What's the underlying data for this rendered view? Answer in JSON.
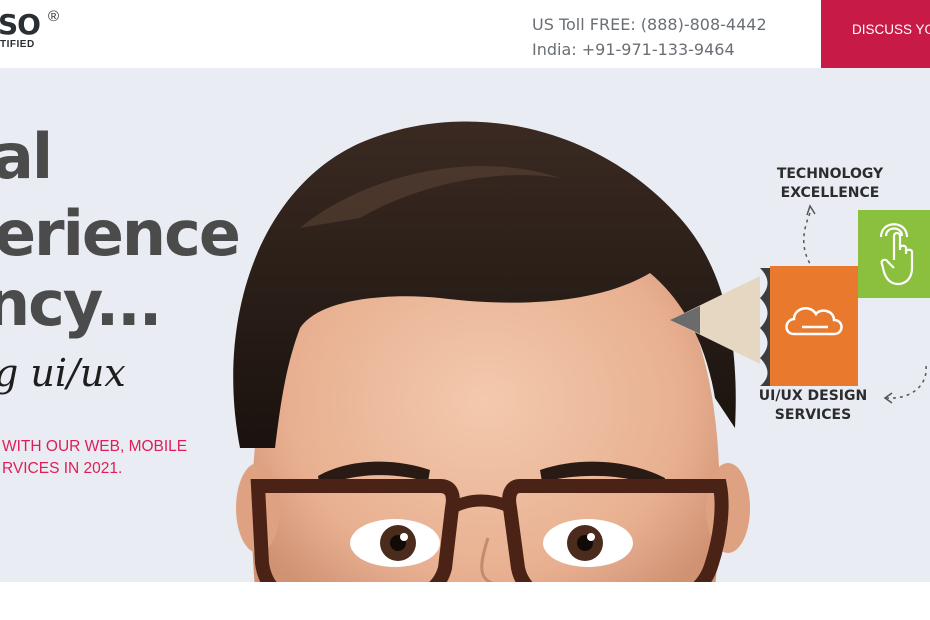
{
  "header": {
    "logo_main": "SO",
    "logo_reg": "®",
    "logo_sub": "TIFIED",
    "phone_us": "US Toll FREE: (888)-808-4442",
    "phone_india": "India: +91-971-133-9464",
    "cta_label": "DISCUSS YO"
  },
  "hero": {
    "headline_line1": "al",
    "headline_line2": "erience",
    "headline_line3": "ncy...",
    "script_line": "g ui/ux",
    "tagline_line1": "WITH OUR WEB, MOBILE",
    "tagline_line2": "RVICES IN 2021."
  },
  "diagram": {
    "top_label_line1": "TECHNOLOGY",
    "top_label_line2": "EXCELLENCE",
    "bottom_label_line1": "UI/UX DESIGN",
    "bottom_label_line2": "SERVICES",
    "icons": [
      "cloud-icon",
      "touch-hand-icon"
    ]
  },
  "colors": {
    "accent": "#c81a47",
    "tagline": "#e01d57",
    "hero_bg": "#e9edf3",
    "orange_block": "#e8792d",
    "green_block": "#8bbf3e"
  }
}
